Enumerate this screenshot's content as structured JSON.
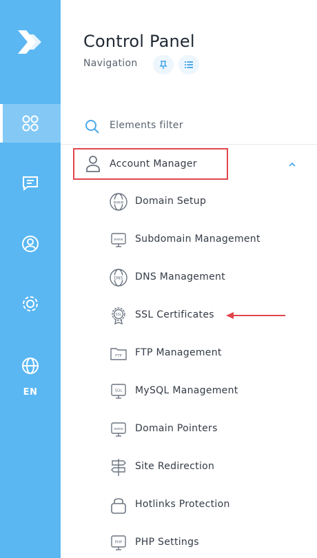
{
  "colors": {
    "rail": "#5ab7f2",
    "rail_active": "#84c9f6",
    "highlight_box": "#e0454b",
    "accent": "#5ab7f2"
  },
  "rail": {
    "items": [
      {
        "icon": "apps-grid-icon",
        "active": true
      },
      {
        "icon": "chat-icon",
        "active": false
      },
      {
        "icon": "user-circle-icon",
        "active": false
      },
      {
        "icon": "settings-gear-icon",
        "active": false
      },
      {
        "icon": "globe-icon",
        "active": false
      }
    ],
    "language": "EN"
  },
  "panel": {
    "title": "Control Panel",
    "subtitle": "Navigation",
    "filter_placeholder": "Elements filter"
  },
  "section": {
    "label": "Account Manager",
    "expanded": true,
    "items": [
      {
        "label": "Domain Setup",
        "icon": "www-globe-icon"
      },
      {
        "label": "Subdomain Management",
        "icon": "www-monitor-icon"
      },
      {
        "label": "DNS Management",
        "icon": "dns-globe-icon"
      },
      {
        "label": "SSL Certificates",
        "icon": "ssl-badge-icon"
      },
      {
        "label": "FTP Management",
        "icon": "ftp-folder-icon"
      },
      {
        "label": "MySQL Management",
        "icon": "sql-monitor-icon"
      },
      {
        "label": "Domain Pointers",
        "icon": "www-monitor-icon"
      },
      {
        "label": "Site Redirection",
        "icon": "signpost-icon"
      },
      {
        "label": "Hotlinks Protection",
        "icon": "lock-icon"
      },
      {
        "label": "PHP Settings",
        "icon": "php-monitor-icon"
      }
    ]
  }
}
